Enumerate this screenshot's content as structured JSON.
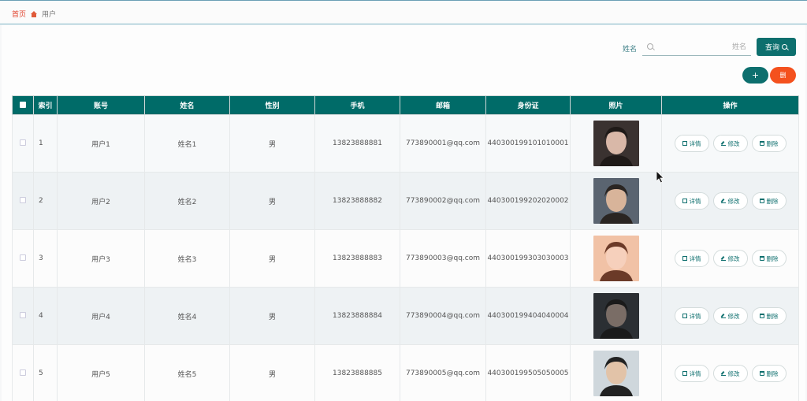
{
  "breadcrumb": {
    "home": "首页",
    "current": "用户"
  },
  "search": {
    "label": "姓名",
    "placeholder": "姓名",
    "value": ""
  },
  "toolbar": {
    "query_label": "查询",
    "add_label": "+",
    "delete_label": "删"
  },
  "table": {
    "headers": {
      "index": "索引",
      "account": "账号",
      "name": "姓名",
      "gender": "性别",
      "phone": "手机",
      "email": "邮箱",
      "idcard": "身份证",
      "photo": "照片",
      "actions": "操作"
    },
    "rows": [
      {
        "index": "1",
        "account": "用户1",
        "name": "姓名1",
        "gender": "男",
        "phone": "13823888881",
        "email": "773890001@qq.com",
        "idcard": "440300199101010001"
      },
      {
        "index": "2",
        "account": "用户2",
        "name": "姓名2",
        "gender": "男",
        "phone": "13823888882",
        "email": "773890002@qq.com",
        "idcard": "440300199202020002"
      },
      {
        "index": "3",
        "account": "用户3",
        "name": "姓名3",
        "gender": "男",
        "phone": "13823888883",
        "email": "773890003@qq.com",
        "idcard": "440300199303030003"
      },
      {
        "index": "4",
        "account": "用户4",
        "name": "姓名4",
        "gender": "男",
        "phone": "13823888884",
        "email": "773890004@qq.com",
        "idcard": "440300199404040004"
      },
      {
        "index": "5",
        "account": "用户5",
        "name": "姓名5",
        "gender": "男",
        "phone": "13823888885",
        "email": "773890005@qq.com",
        "idcard": "440300199505050005"
      }
    ],
    "actions": {
      "detail": "详情",
      "edit": "修改",
      "delete": "删除"
    }
  },
  "colors": {
    "primary": "#006b68",
    "danger": "#f4511e",
    "breadcrumb_home": "#e0422c"
  },
  "icons": {
    "home": "home-icon",
    "search": "search-icon",
    "detail": "document-icon",
    "edit": "pen-icon",
    "delete": "trash-icon"
  }
}
